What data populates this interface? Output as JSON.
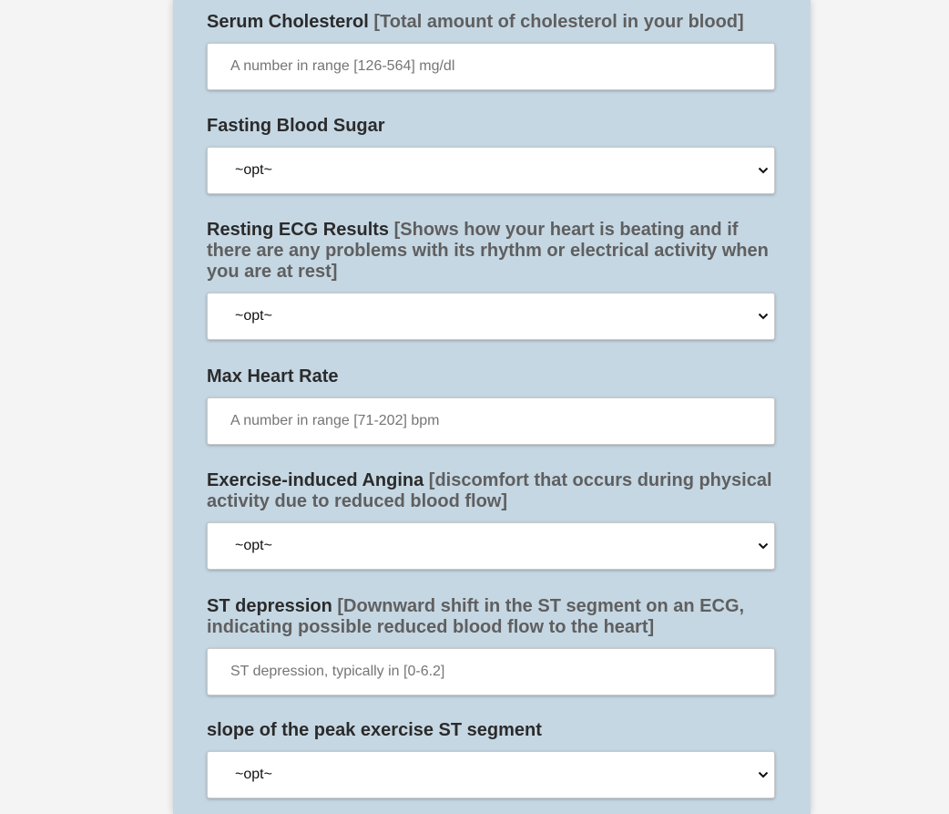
{
  "form": {
    "fields": [
      {
        "label": "Serum Cholesterol",
        "hint": "[Total amount of cholesterol in your blood]",
        "type": "input",
        "value": "",
        "placeholder": "A number in range [126-564] mg/dl"
      },
      {
        "label": "Fasting Blood Sugar",
        "hint": "",
        "type": "select",
        "value": "~opt~"
      },
      {
        "label": "Resting ECG Results",
        "hint": "[Shows how your heart is beating and if there are any problems with its rhythm or electrical activity when you are at rest]",
        "type": "select",
        "value": "~opt~"
      },
      {
        "label": "Max Heart Rate",
        "hint": "",
        "type": "input",
        "value": "",
        "placeholder": "A number in range [71-202] bpm"
      },
      {
        "label": "Exercise-induced Angina",
        "hint": "[discomfort that occurs during physical activity due to reduced blood flow]",
        "type": "select",
        "value": "~opt~"
      },
      {
        "label": "ST depression",
        "hint": "[Downward shift in the ST segment on an ECG, indicating possible reduced blood flow to the heart]",
        "type": "input",
        "value": "",
        "placeholder": "ST depression, typically in [0-6.2]"
      },
      {
        "label": "slope of the peak exercise ST segment",
        "hint": "",
        "type": "select",
        "value": "~opt~"
      }
    ]
  },
  "icons": {
    "select_arrow": "chevron-down-icon"
  },
  "colors": {
    "panel": "#c5d7e3",
    "page": "#f4f4f4",
    "label": "#2b2b2b",
    "hint": "#5f5f5f"
  }
}
